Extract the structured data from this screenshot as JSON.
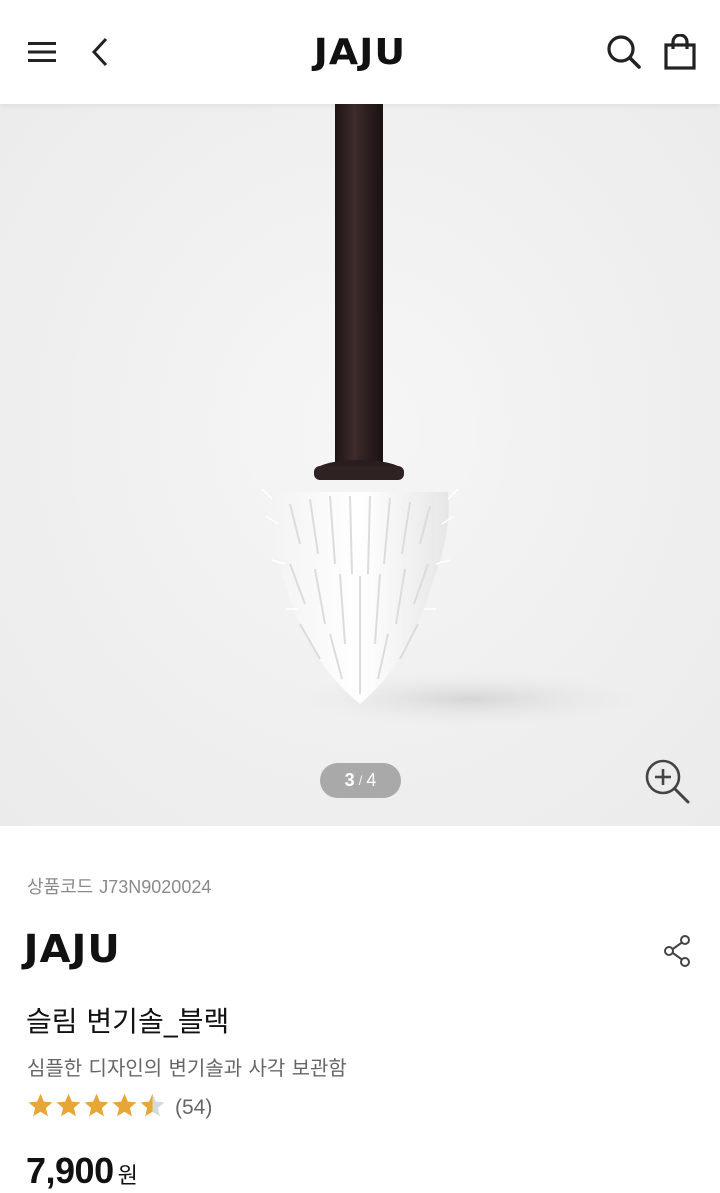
{
  "header": {
    "logo": "JAJU",
    "menu_icon": "hamburger-menu-icon",
    "back_icon": "chevron-left-icon",
    "search_icon": "search-icon",
    "cart_icon": "shopping-bag-icon"
  },
  "gallery": {
    "current": "3",
    "separator": "/",
    "total": "4",
    "zoom_icon": "zoom-in-icon",
    "background_color": "#efefef"
  },
  "product": {
    "code_label": "상품코드",
    "code_value": "J73N9020024",
    "brand": "JAJU",
    "share_icon": "share-icon",
    "title": "슬림 변기솔_블랙",
    "subtitle": "심플한 디자인의 변기솔과 사각 보관함",
    "rating": 4.5,
    "rating_max": 5,
    "review_count": "(54)",
    "price": "7,900",
    "price_unit": "원"
  },
  "colors": {
    "star": "#e7a635",
    "star_empty": "#d9d9d9",
    "pager_bg": "#a9a9a9",
    "text_primary": "#111111",
    "text_secondary": "#666666"
  }
}
